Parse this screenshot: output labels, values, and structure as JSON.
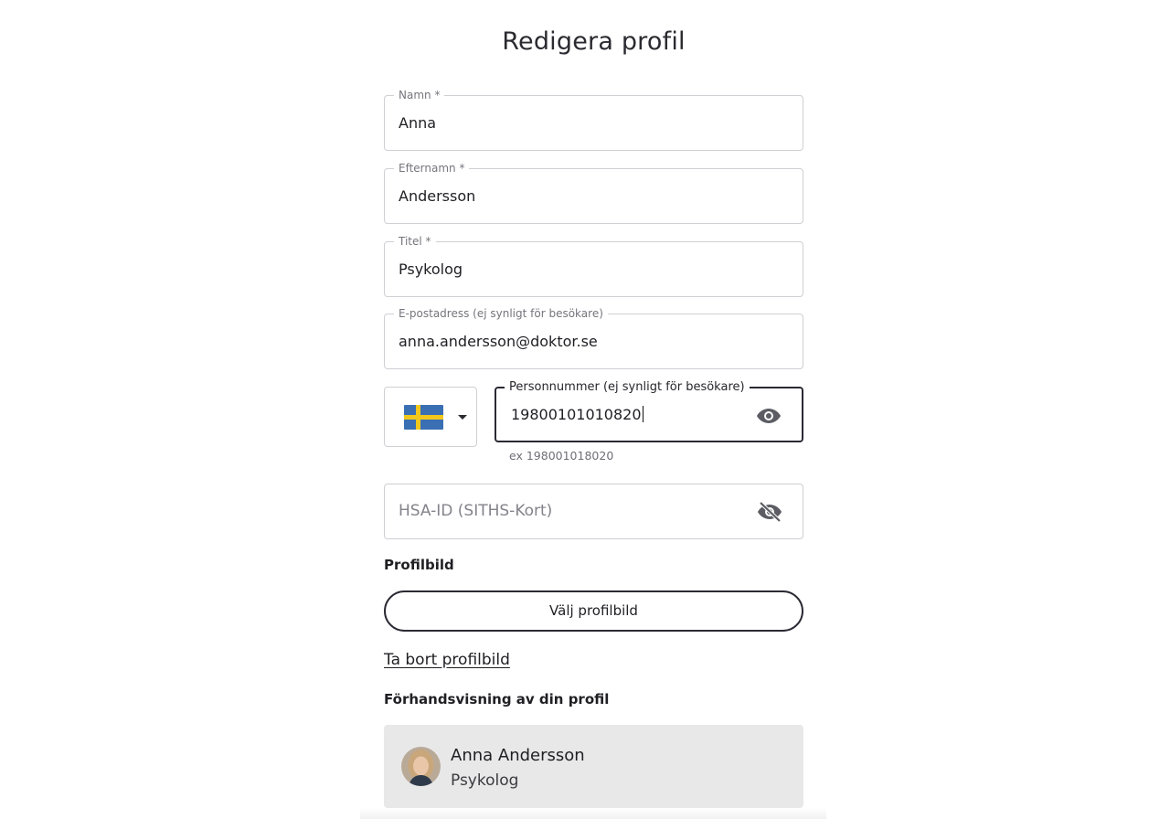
{
  "page": {
    "title": "Redigera profil"
  },
  "form": {
    "first_name": {
      "label": "Namn *",
      "value": "Anna"
    },
    "last_name": {
      "label": "Efternamn *",
      "value": "Andersson"
    },
    "title": {
      "label": "Titel *",
      "value": "Psykolog"
    },
    "email": {
      "label": "E-postadress (ej synligt för besökare)",
      "value": "anna.andersson@doktor.se"
    },
    "country": {
      "selected": "Sweden",
      "flag_icon": "sweden-flag-icon"
    },
    "personal_number": {
      "label": "Personnummer (ej synligt för besökare)",
      "value": "19800101010820",
      "helper": "ex 198001018020",
      "toggle_icon": "eye-icon"
    },
    "hsa_id": {
      "placeholder": "HSA-ID (SITHS-Kort)",
      "toggle_icon": "eye-off-icon"
    }
  },
  "profile_picture": {
    "label": "Profilbild",
    "choose_button": "Välj profilbild",
    "remove_link": "Ta bort profilbild"
  },
  "preview": {
    "label": "Förhandsvisning av din profil",
    "name": "Anna Andersson",
    "title": "Psykolog"
  },
  "colors": {
    "primary_border": "#2a2a34",
    "field_border": "#cfcfd4",
    "preview_background": "#e8e8e8",
    "flag_blue": "#3a6fb4",
    "flag_yellow": "#f3c81d"
  }
}
